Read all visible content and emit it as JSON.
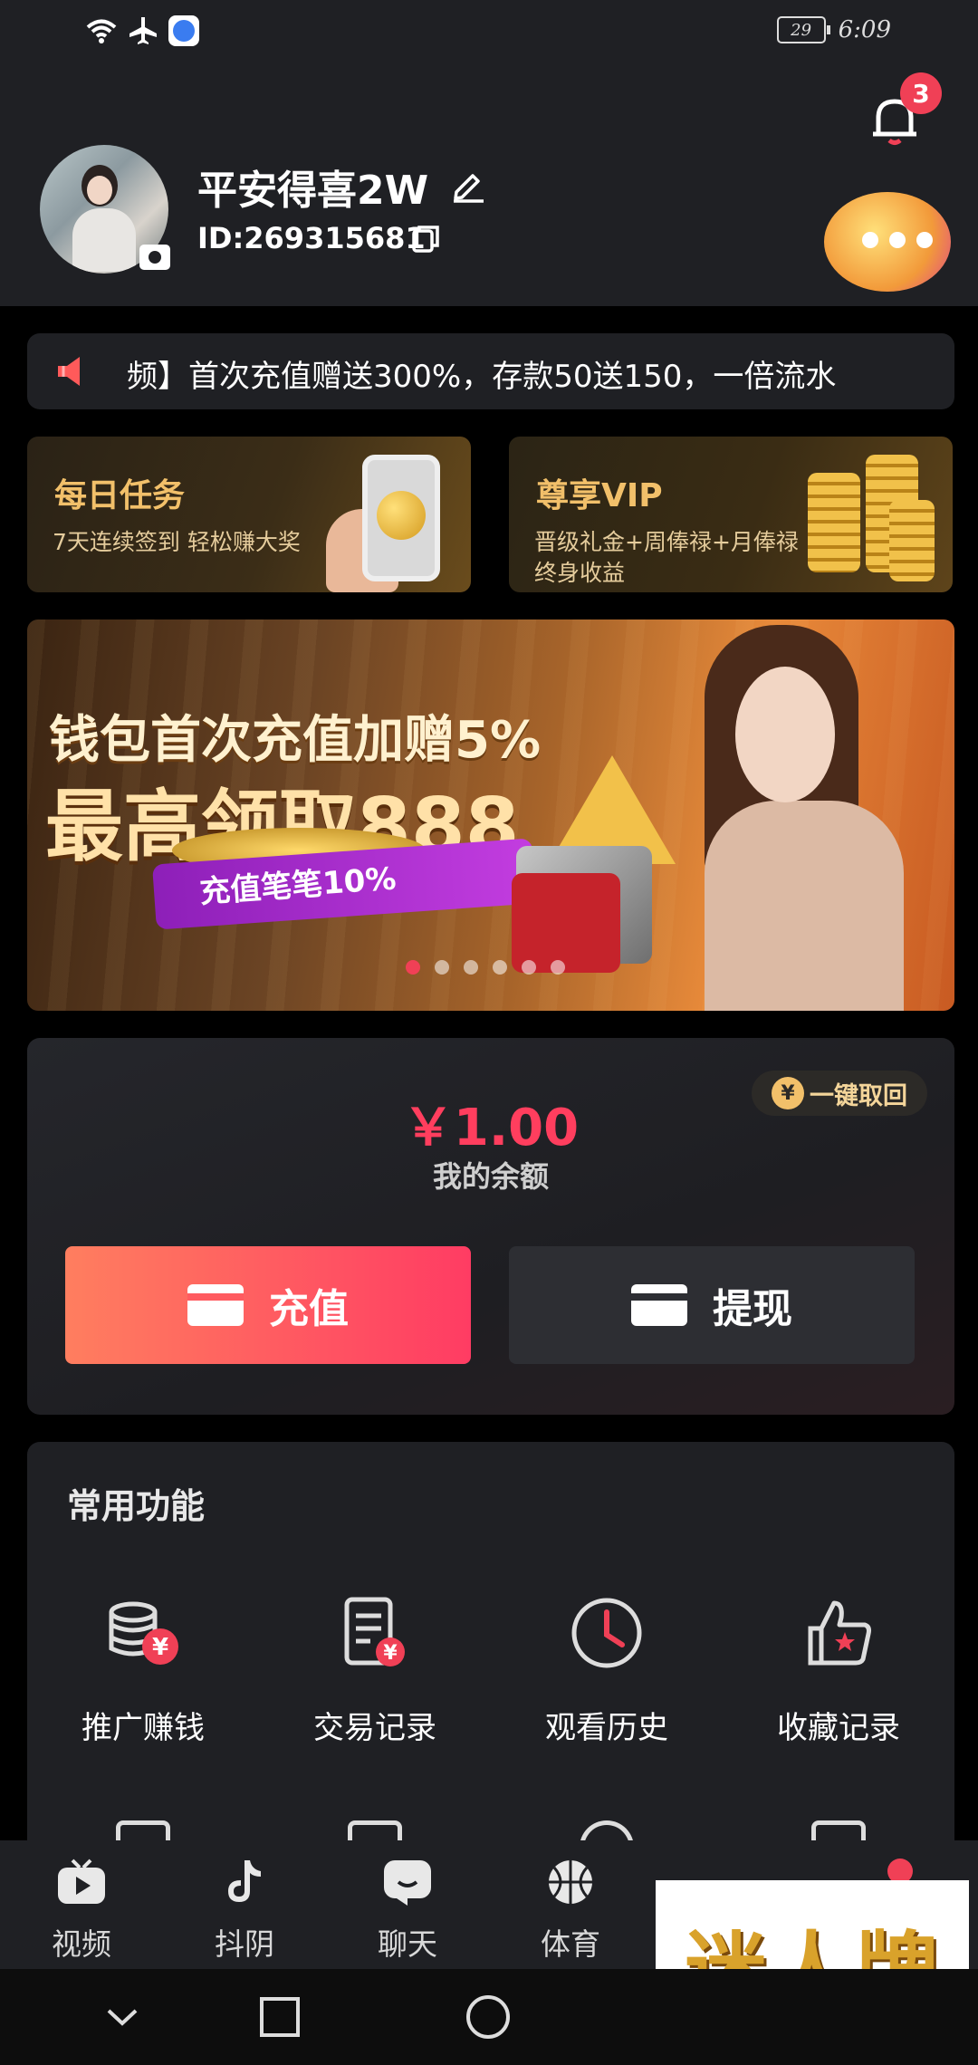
{
  "status_bar": {
    "icons": [
      "wifi-icon",
      "airplane-icon",
      "app-icon"
    ],
    "battery": "29",
    "time": "6:09"
  },
  "notifications": {
    "badge_count": "3"
  },
  "profile": {
    "username": "平安得喜2W",
    "user_id": "ID:269315681"
  },
  "notice": {
    "text": "频】首次充值赠送300%，存款50送150，一倍流水"
  },
  "promo_cards": {
    "daily": {
      "title": "每日任务",
      "subtitle": "7天连续签到 轻松赚大奖"
    },
    "vip": {
      "title": "尊享VIP",
      "subtitle_line1": "晋级礼金+周俸禄+月俸禄",
      "subtitle_line2": "终身收益"
    }
  },
  "banner": {
    "line1": "钱包首次充值加赠5%",
    "line2": "最高领取888",
    "ribbon": "充值笔笔10%",
    "slide_count": 6,
    "active_slide": 1
  },
  "wallet": {
    "retrieve_label": "一键取回",
    "retrieve_icon_glyph": "¥",
    "balance": "￥1.00",
    "balance_label": "我的余额",
    "recharge_label": "充值",
    "withdraw_label": "提现"
  },
  "features": {
    "title": "常用功能",
    "items": [
      {
        "label": "推广赚钱",
        "icon": "coins-yuan-icon"
      },
      {
        "label": "交易记录",
        "icon": "receipt-icon"
      },
      {
        "label": "观看历史",
        "icon": "clock-icon"
      },
      {
        "label": "收藏记录",
        "icon": "thumbs-up-star-icon"
      }
    ]
  },
  "bottom_nav": {
    "items": [
      {
        "label": "视频",
        "icon": "tv-play-icon"
      },
      {
        "label": "抖阴",
        "icon": "tiktok-icon"
      },
      {
        "label": "聊天",
        "icon": "chat-icon"
      },
      {
        "label": "体育",
        "icon": "basketball-icon"
      }
    ]
  },
  "watermark": "迷人牌",
  "colors": {
    "accent": "#ff3e5e",
    "gold": "#f2c06a",
    "panel": "#1f2024",
    "background": "#000000"
  }
}
